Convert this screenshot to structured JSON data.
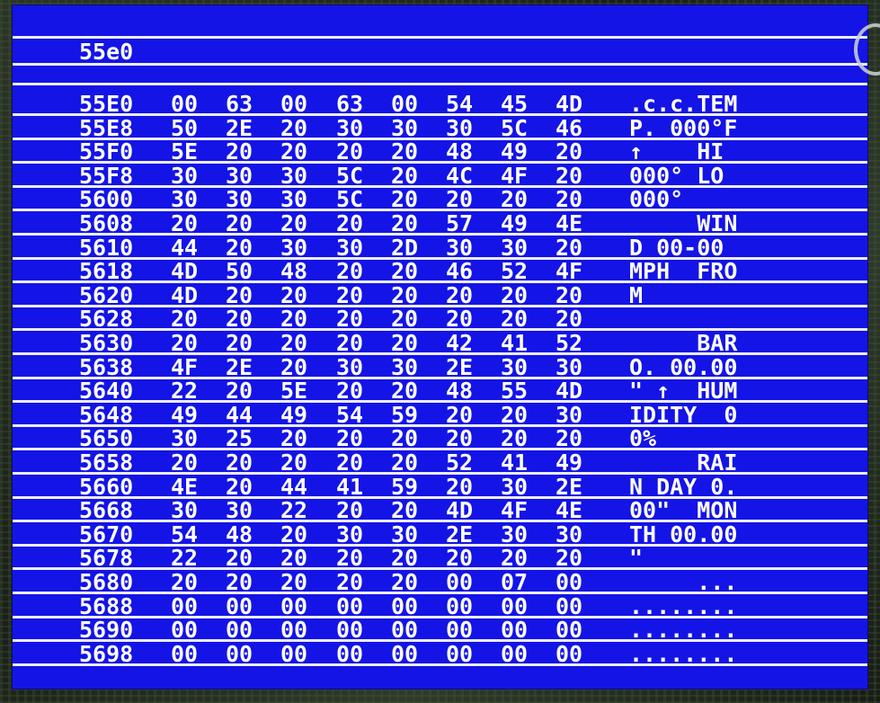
{
  "screen": {
    "bg_color": "#1414e6",
    "fg_color": "#ffffff",
    "header_address": "55e0",
    "rows": [
      {
        "addr": "55E0",
        "bytes": [
          "00",
          "63",
          "00",
          "63",
          "00",
          "54",
          "45",
          "4D"
        ],
        "ascii": ".c.c.TEM"
      },
      {
        "addr": "55E8",
        "bytes": [
          "50",
          "2E",
          "20",
          "30",
          "30",
          "30",
          "5C",
          "46"
        ],
        "ascii": "P. 000°F"
      },
      {
        "addr": "55F0",
        "bytes": [
          "5E",
          "20",
          "20",
          "20",
          "20",
          "48",
          "49",
          "20"
        ],
        "ascii": "↑    HI"
      },
      {
        "addr": "55F8",
        "bytes": [
          "30",
          "30",
          "30",
          "5C",
          "20",
          "4C",
          "4F",
          "20"
        ],
        "ascii": "000° LO"
      },
      {
        "addr": "5600",
        "bytes": [
          "30",
          "30",
          "30",
          "5C",
          "20",
          "20",
          "20",
          "20"
        ],
        "ascii": "000°"
      },
      {
        "addr": "5608",
        "bytes": [
          "20",
          "20",
          "20",
          "20",
          "20",
          "57",
          "49",
          "4E"
        ],
        "ascii": "     WIN"
      },
      {
        "addr": "5610",
        "bytes": [
          "44",
          "20",
          "30",
          "30",
          "2D",
          "30",
          "30",
          "20"
        ],
        "ascii": "D 00-00"
      },
      {
        "addr": "5618",
        "bytes": [
          "4D",
          "50",
          "48",
          "20",
          "20",
          "46",
          "52",
          "4F"
        ],
        "ascii": "MPH  FRO"
      },
      {
        "addr": "5620",
        "bytes": [
          "4D",
          "20",
          "20",
          "20",
          "20",
          "20",
          "20",
          "20"
        ],
        "ascii": "M"
      },
      {
        "addr": "5628",
        "bytes": [
          "20",
          "20",
          "20",
          "20",
          "20",
          "20",
          "20",
          "20"
        ],
        "ascii": ""
      },
      {
        "addr": "5630",
        "bytes": [
          "20",
          "20",
          "20",
          "20",
          "20",
          "42",
          "41",
          "52"
        ],
        "ascii": "     BAR"
      },
      {
        "addr": "5638",
        "bytes": [
          "4F",
          "2E",
          "20",
          "30",
          "30",
          "2E",
          "30",
          "30"
        ],
        "ascii": "O. 00.00"
      },
      {
        "addr": "5640",
        "bytes": [
          "22",
          "20",
          "5E",
          "20",
          "20",
          "48",
          "55",
          "4D"
        ],
        "ascii": "\" ↑  HUM"
      },
      {
        "addr": "5648",
        "bytes": [
          "49",
          "44",
          "49",
          "54",
          "59",
          "20",
          "20",
          "30"
        ],
        "ascii": "IDITY  0"
      },
      {
        "addr": "5650",
        "bytes": [
          "30",
          "25",
          "20",
          "20",
          "20",
          "20",
          "20",
          "20"
        ],
        "ascii": "0%"
      },
      {
        "addr": "5658",
        "bytes": [
          "20",
          "20",
          "20",
          "20",
          "20",
          "52",
          "41",
          "49"
        ],
        "ascii": "     RAI"
      },
      {
        "addr": "5660",
        "bytes": [
          "4E",
          "20",
          "44",
          "41",
          "59",
          "20",
          "30",
          "2E"
        ],
        "ascii": "N DAY 0."
      },
      {
        "addr": "5668",
        "bytes": [
          "30",
          "30",
          "22",
          "20",
          "20",
          "4D",
          "4F",
          "4E"
        ],
        "ascii": "00\"  MON"
      },
      {
        "addr": "5670",
        "bytes": [
          "54",
          "48",
          "20",
          "30",
          "30",
          "2E",
          "30",
          "30"
        ],
        "ascii": "TH 00.00"
      },
      {
        "addr": "5678",
        "bytes": [
          "22",
          "20",
          "20",
          "20",
          "20",
          "20",
          "20",
          "20"
        ],
        "ascii": "\""
      },
      {
        "addr": "5680",
        "bytes": [
          "20",
          "20",
          "20",
          "20",
          "20",
          "00",
          "07",
          "00"
        ],
        "ascii": "     ..."
      },
      {
        "addr": "5688",
        "bytes": [
          "00",
          "00",
          "00",
          "00",
          "00",
          "00",
          "00",
          "00"
        ],
        "ascii": "........"
      },
      {
        "addr": "5690",
        "bytes": [
          "00",
          "00",
          "00",
          "00",
          "00",
          "00",
          "00",
          "00"
        ],
        "ascii": "........"
      },
      {
        "addr": "5698",
        "bytes": [
          "00",
          "00",
          "00",
          "00",
          "00",
          "00",
          "00",
          "00"
        ],
        "ascii": "........"
      }
    ]
  }
}
